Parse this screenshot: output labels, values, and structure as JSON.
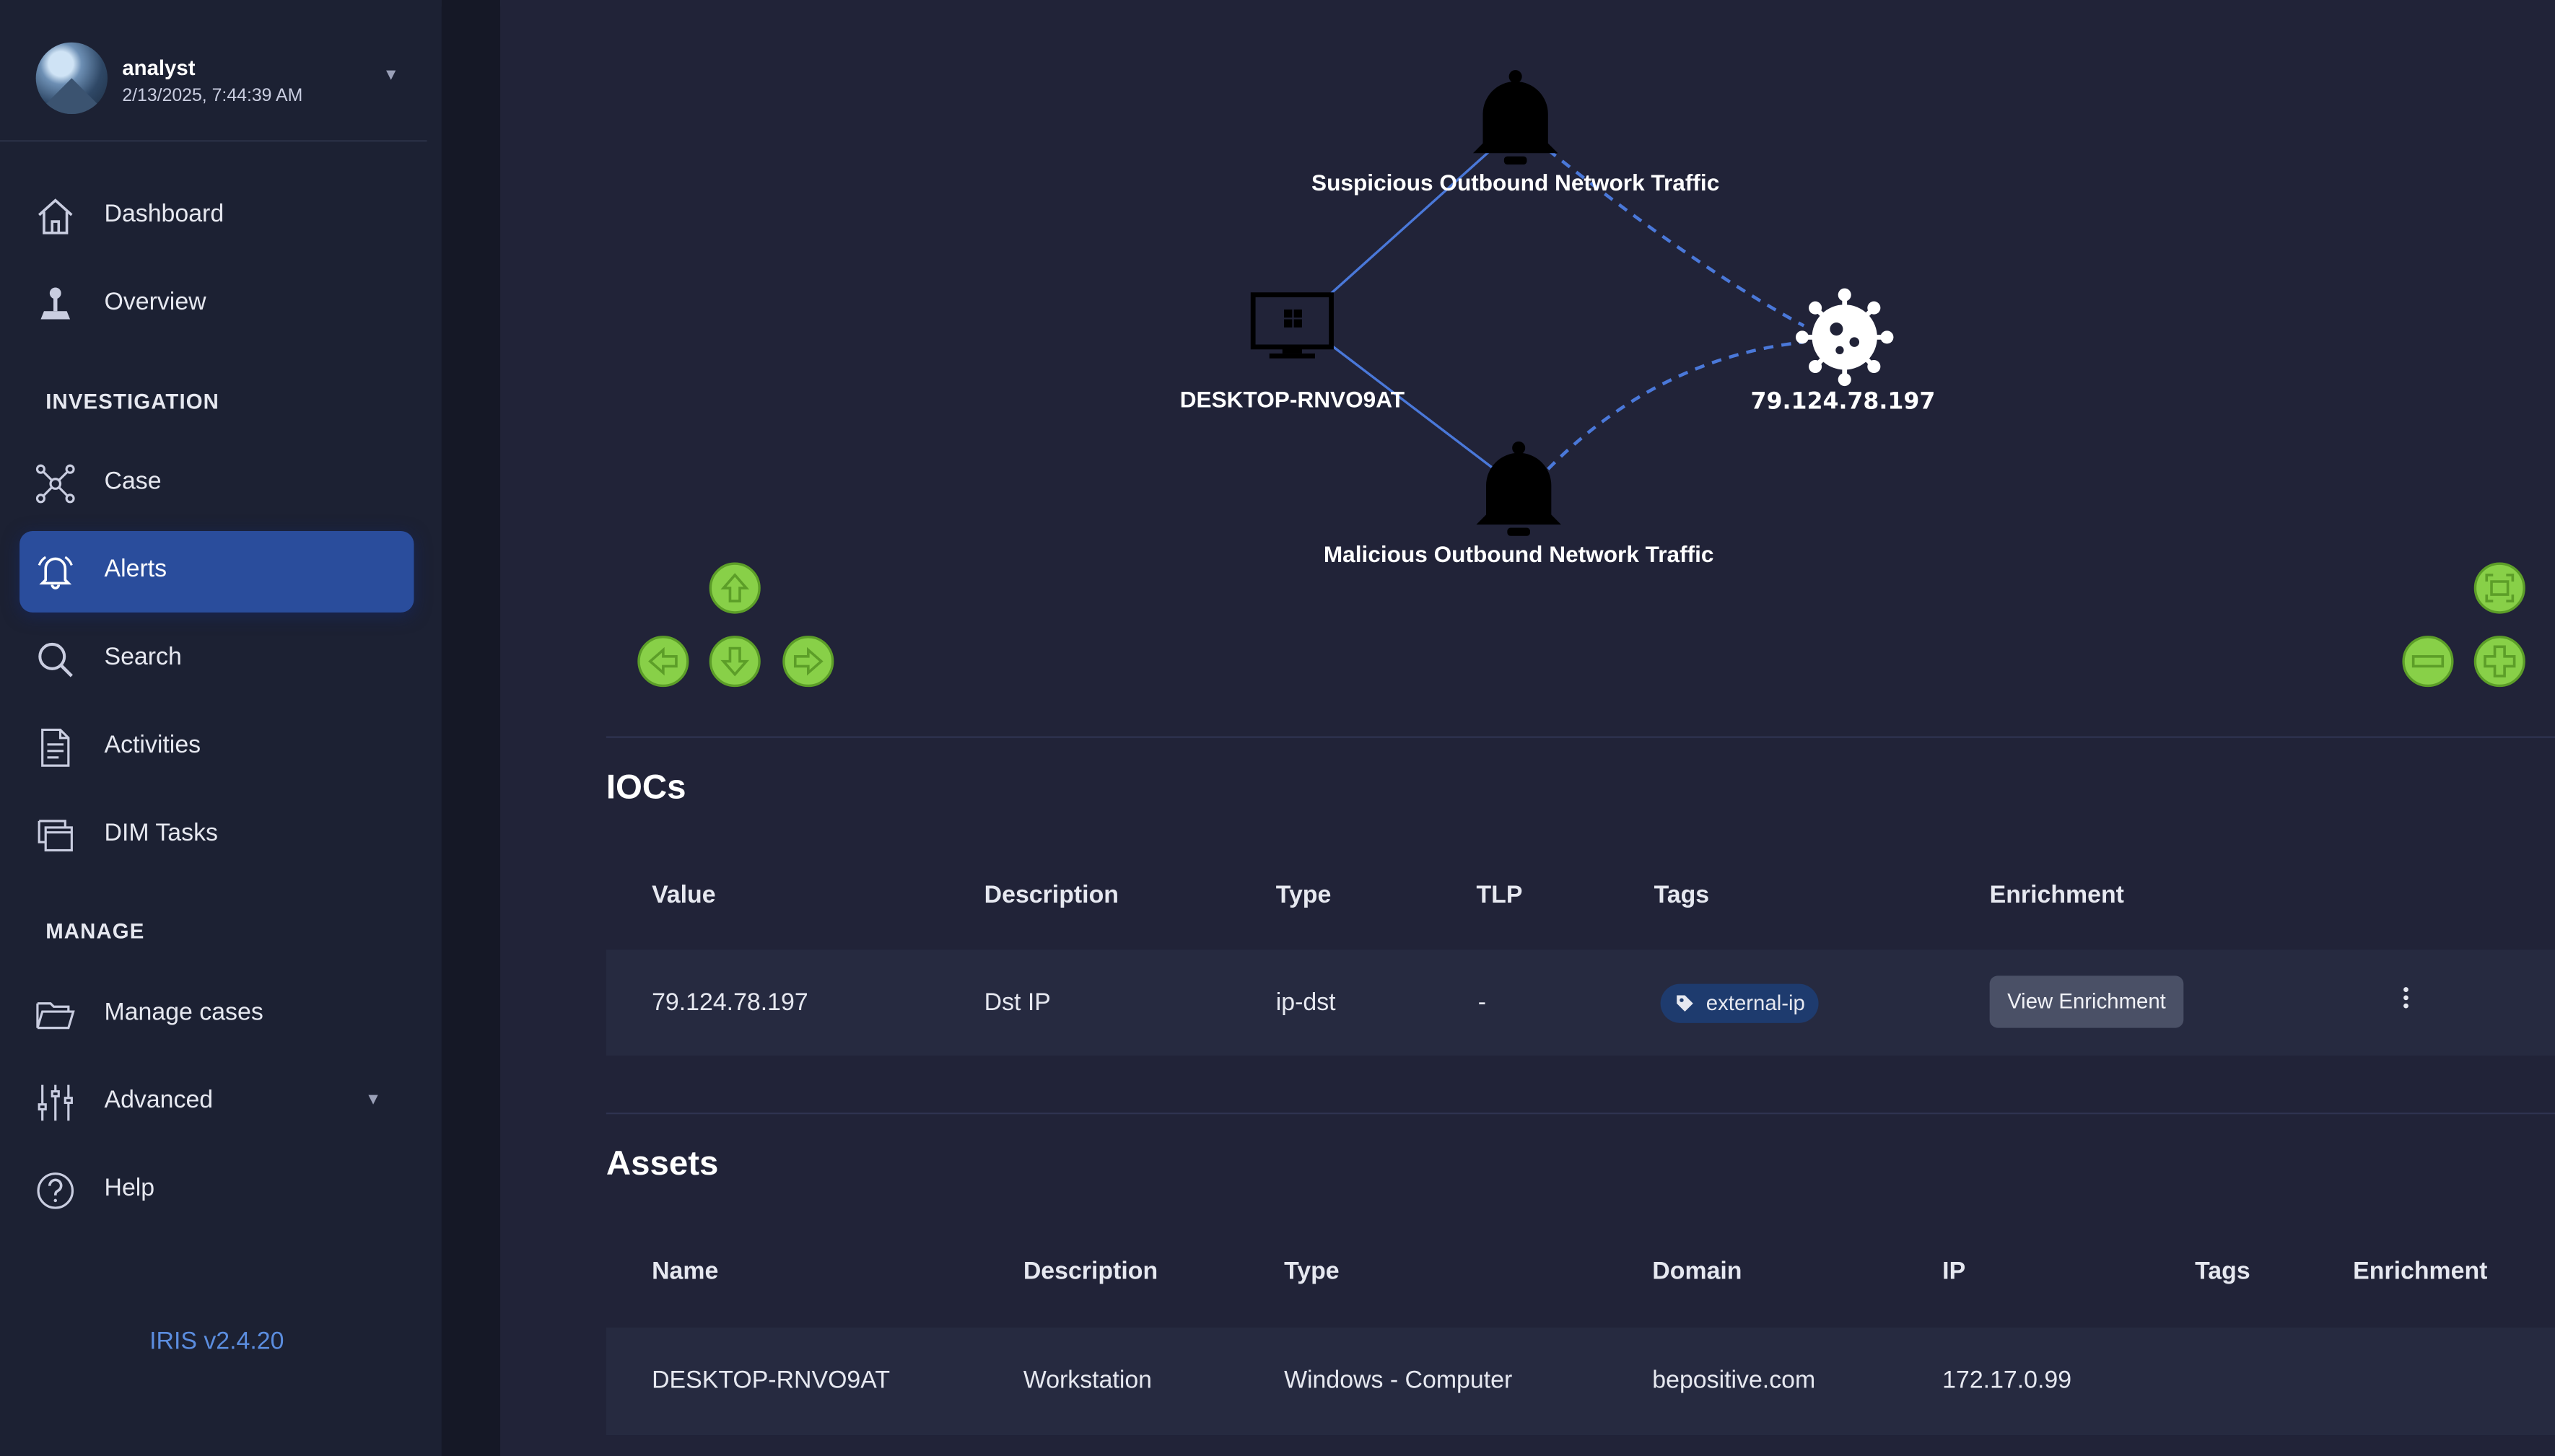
{
  "user": {
    "name": "analyst",
    "datetime": "2/13/2025, 7:44:39 AM"
  },
  "nav": {
    "dashboard": "Dashboard",
    "overview": "Overview",
    "section_investigation": "INVESTIGATION",
    "case": "Case",
    "alerts": "Alerts",
    "search": "Search",
    "activities": "Activities",
    "dim_tasks": "DIM Tasks",
    "section_manage": "MANAGE",
    "manage_cases": "Manage cases",
    "advanced": "Advanced",
    "help": "Help",
    "active": "Alerts"
  },
  "version": "IRIS v2.4.20",
  "graph": {
    "nodes": {
      "alert_top": "Suspicious Outbound Network Traffic",
      "host": "DESKTOP-RNVO9AT",
      "ioc": "79.124.78.197",
      "alert_bottom": "Malicious Outbound Network Traffic"
    },
    "control_color": "#7ccc3c",
    "edge_color": "#4a78d9"
  },
  "iocs": {
    "title": "IOCs",
    "columns": [
      "Value",
      "Description",
      "Type",
      "TLP",
      "Tags",
      "Enrichment"
    ],
    "rows": [
      {
        "value": "79.124.78.197",
        "description": "Dst IP",
        "type": "ip-dst",
        "tlp": "-",
        "tag": "external-ip",
        "enrichment_button": "View Enrichment"
      }
    ]
  },
  "assets": {
    "title": "Assets",
    "columns": [
      "Name",
      "Description",
      "Type",
      "Domain",
      "IP",
      "Tags",
      "Enrichment"
    ],
    "rows": [
      {
        "name": "DESKTOP-RNVO9AT",
        "description": "Workstation",
        "type": "Windows - Computer",
        "domain": "bepositive.com",
        "ip": "172.17.0.99"
      }
    ]
  },
  "colors": {
    "sidebar": "#1c2133",
    "main": "#212338",
    "active_nav": "#2a4d9c",
    "tag_bg": "#1e3b6e",
    "version_link": "#5b8ddf"
  }
}
